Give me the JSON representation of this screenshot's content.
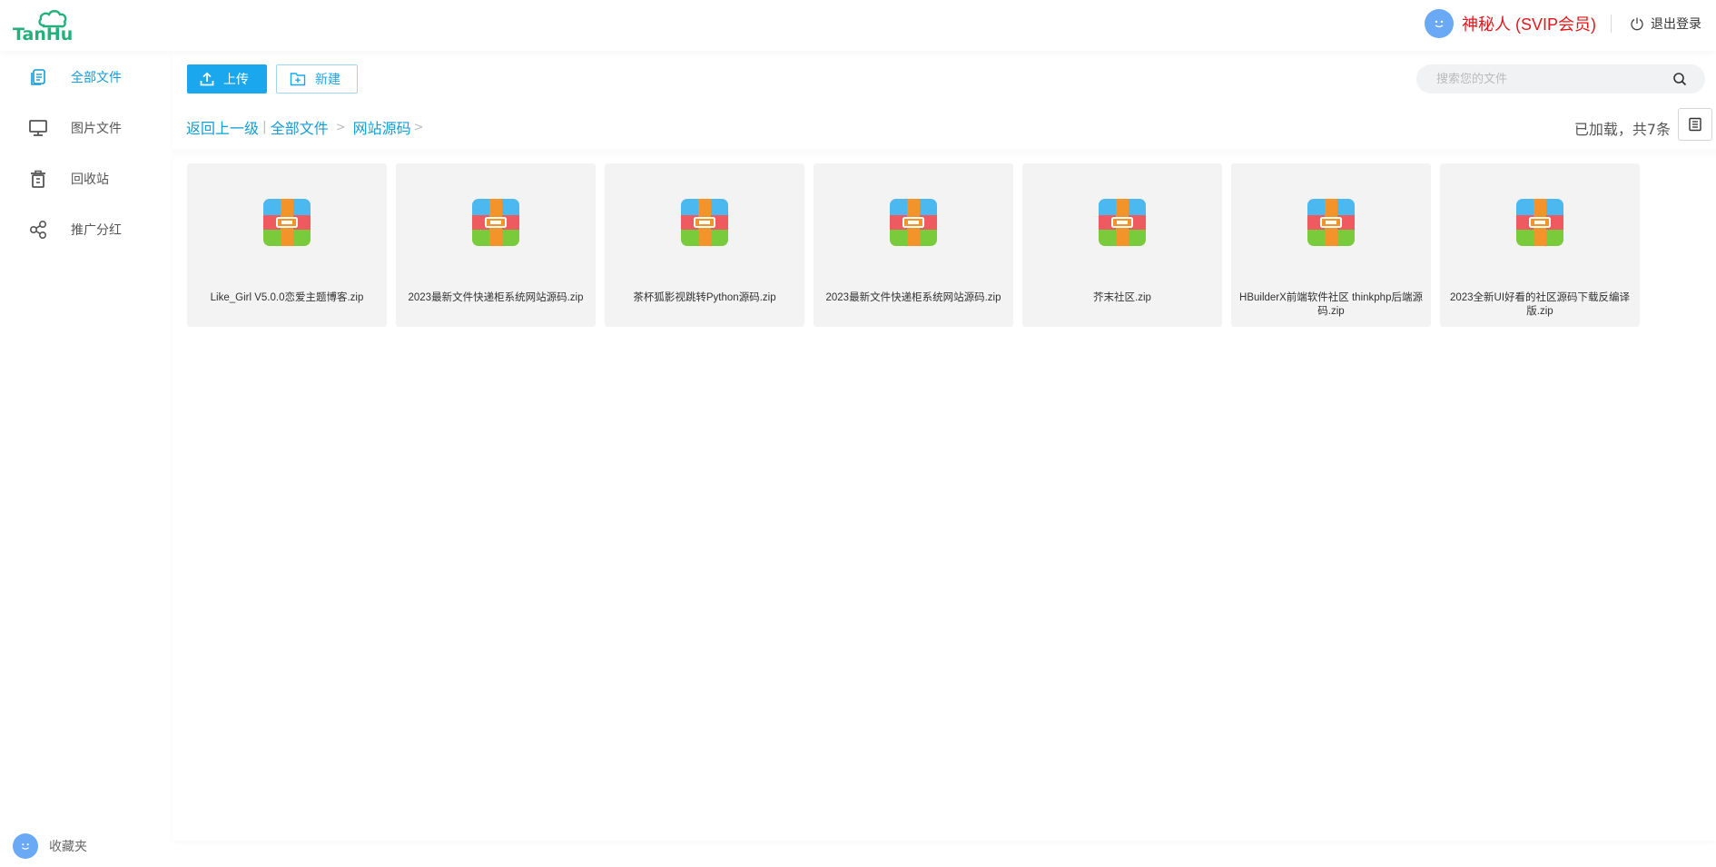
{
  "header": {
    "logo_text": "TanHu",
    "username": "神秘人 (SVIP会员)",
    "logout_label": "退出登录"
  },
  "sidebar": {
    "items": [
      {
        "label": "全部文件",
        "icon": "files-icon",
        "active": true
      },
      {
        "label": "图片文件",
        "icon": "monitor-icon",
        "active": false
      },
      {
        "label": "回收站",
        "icon": "trash-icon",
        "active": false
      },
      {
        "label": "推广分红",
        "icon": "share-icon",
        "active": false
      }
    ],
    "favorites_label": "收藏夹"
  },
  "toolbar": {
    "upload_label": "上传",
    "new_label": "新建"
  },
  "search": {
    "placeholder": "搜索您的文件"
  },
  "breadcrumb": {
    "back_label": "返回上一级",
    "sep": "|",
    "items": [
      "全部文件",
      "网站源码"
    ],
    "arrow": ">"
  },
  "status": {
    "loaded_text": "已加载，共7条"
  },
  "files": [
    {
      "name": "Like_Girl V5.0.0恋爱主题博客.zip",
      "icon": "zip-archive-icon"
    },
    {
      "name": "2023最新文件快递柜系统网站源码.zip",
      "icon": "zip-archive-icon"
    },
    {
      "name": "茶杯狐影视跳转Python源码.zip",
      "icon": "zip-archive-icon"
    },
    {
      "name": "2023最新文件快递柜系统网站源码.zip",
      "icon": "zip-archive-icon"
    },
    {
      "name": "芥末社区.zip",
      "icon": "zip-archive-icon"
    },
    {
      "name": "HBuilderX前端软件社区 thinkphp后端源码.zip",
      "icon": "zip-archive-icon"
    },
    {
      "name": "2023全新UI好看的社区源码下载反编译版.zip",
      "icon": "zip-archive-icon"
    }
  ],
  "colors": {
    "accent": "#1ba7ee",
    "link": "#169bd5",
    "username": "#e0181c",
    "card_bg": "#f3f3f3"
  }
}
